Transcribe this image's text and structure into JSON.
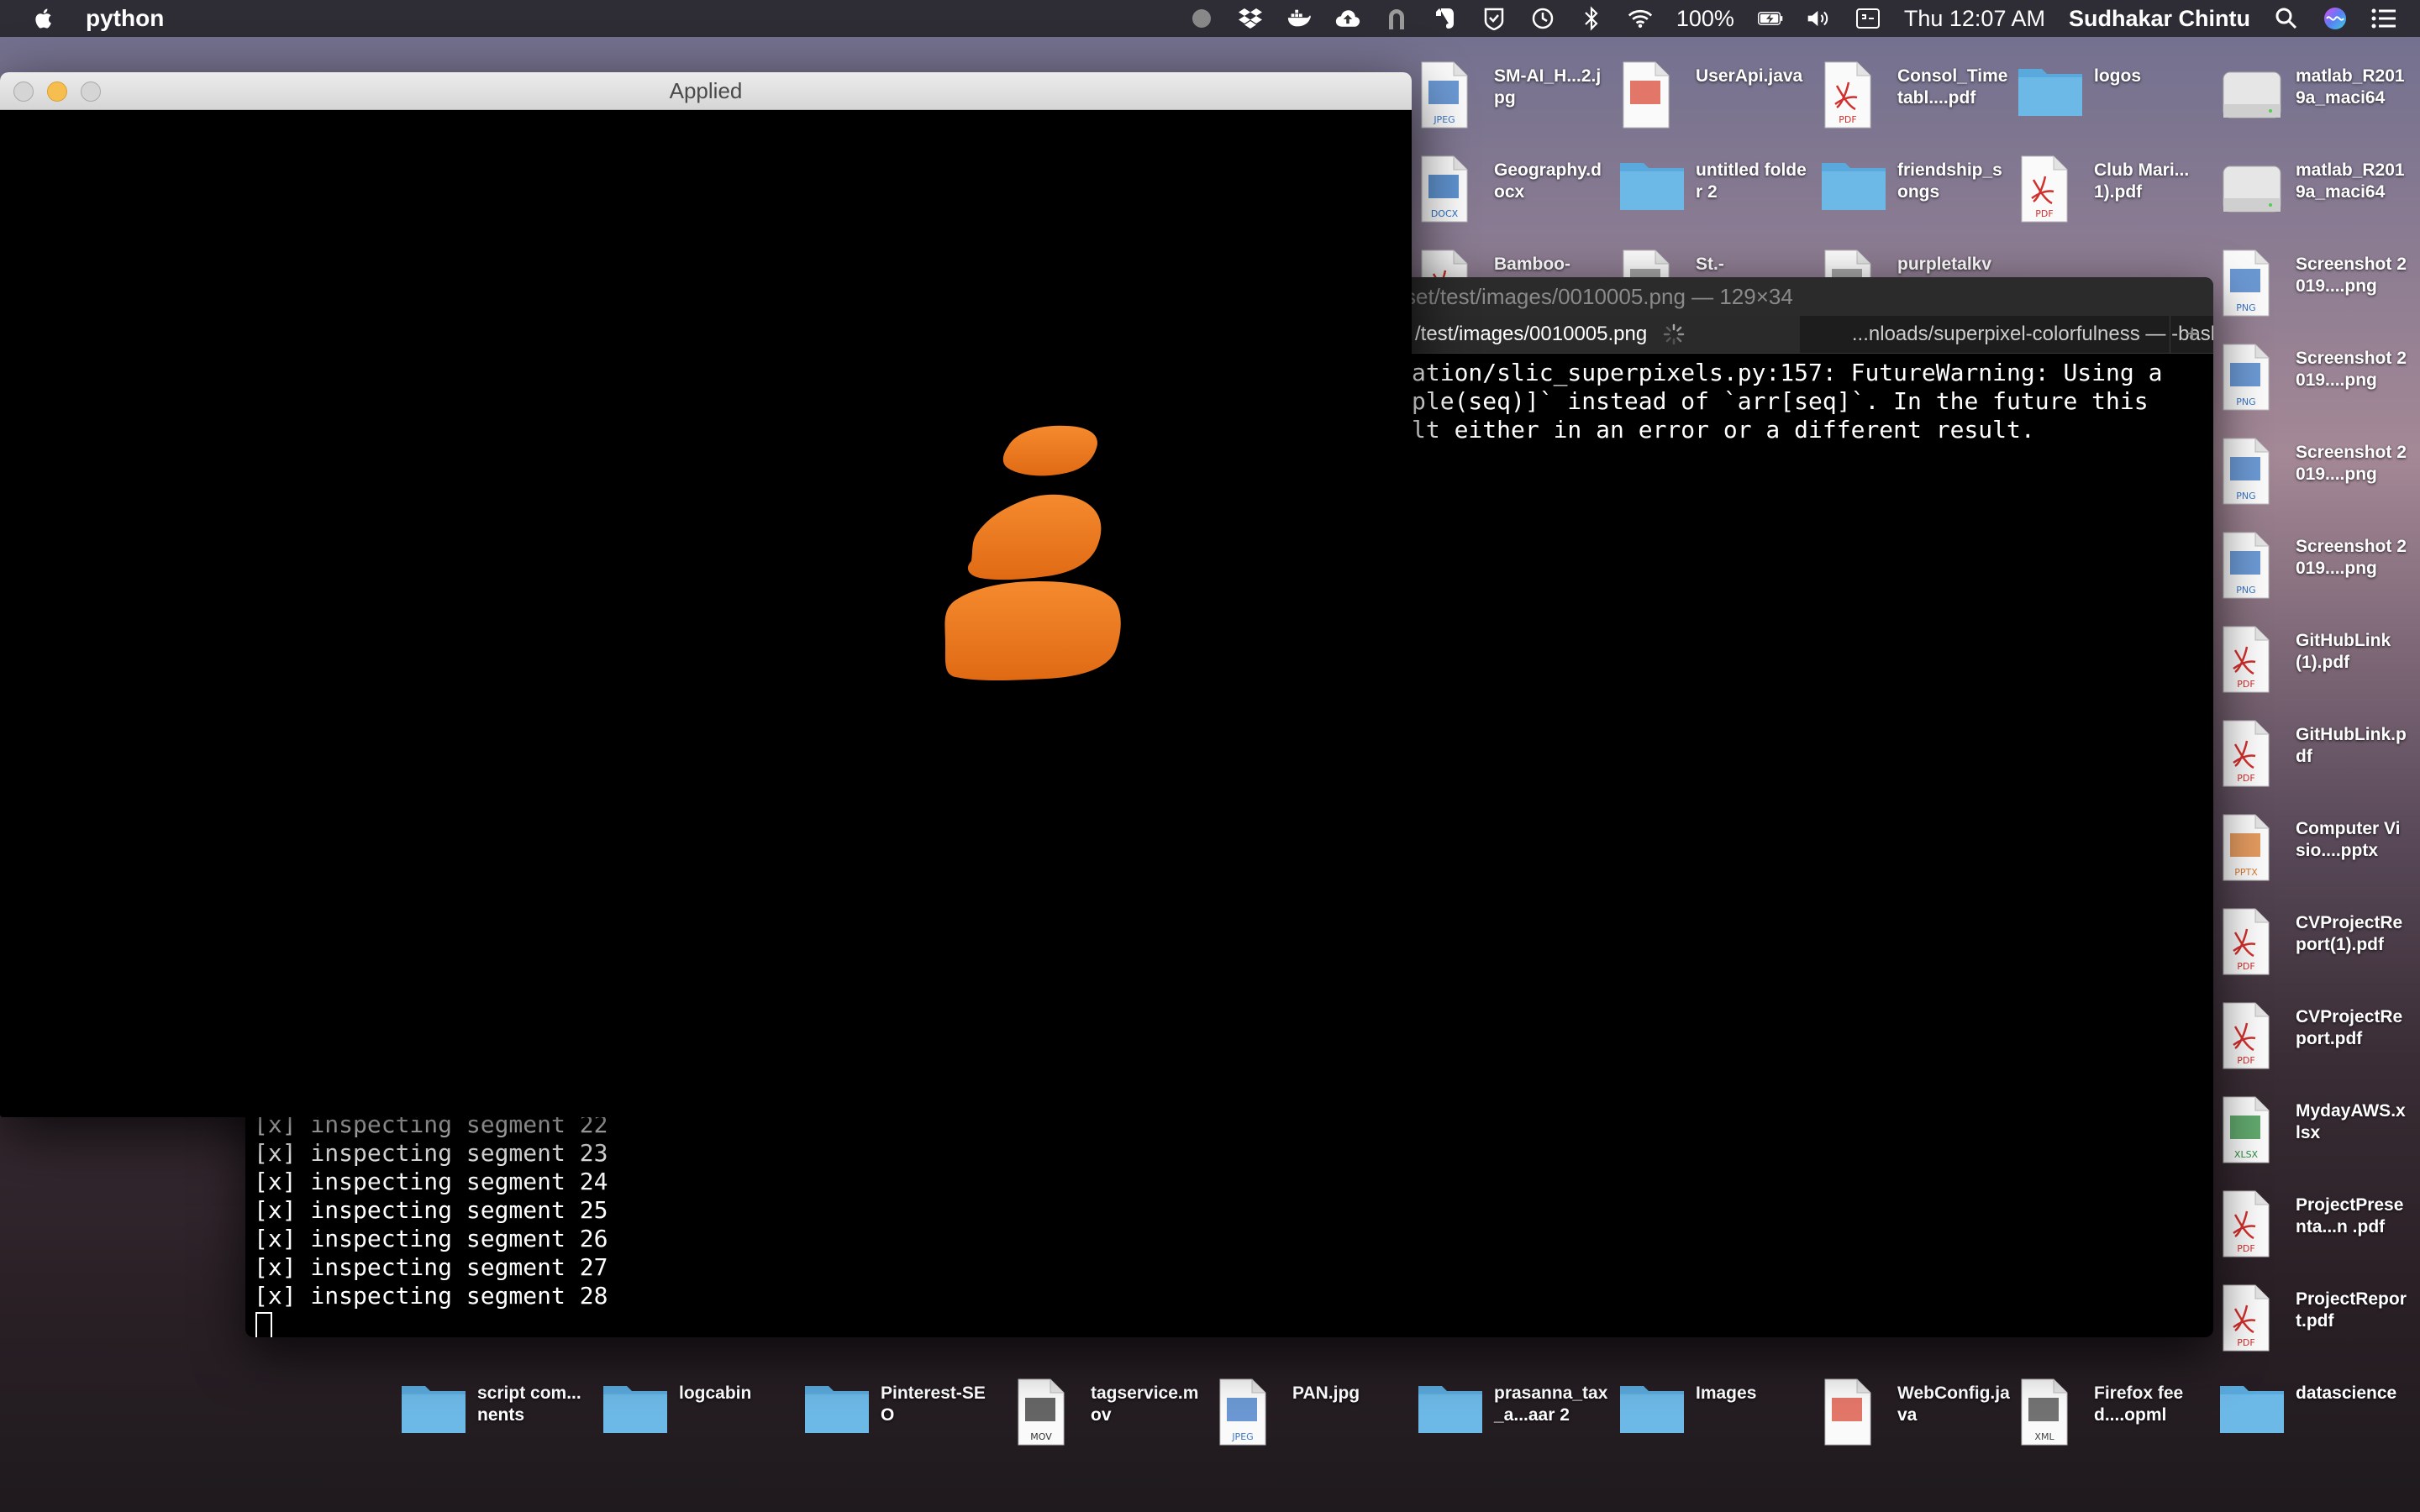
{
  "menubar": {
    "app_name": "python",
    "battery": "100%",
    "clock": "Thu 12:07 AM",
    "user": "Sudhakar Chintu"
  },
  "desktop": {
    "icons": [
      {
        "label": "SM-AI_H...2.jpg",
        "kind": "jpeg"
      },
      {
        "label": "UserApi.java",
        "kind": "java"
      },
      {
        "label": "Consol_Timetabl....pdf",
        "kind": "pdf"
      },
      {
        "label": "logos",
        "kind": "folder"
      },
      {
        "label": "matlab_R2019a_maci64",
        "kind": "disk"
      },
      {
        "label": "Geography.docx",
        "kind": "docx"
      },
      {
        "label": "untitled folder 2",
        "kind": "folder"
      },
      {
        "label": "friendship_songs",
        "kind": "folder"
      },
      {
        "label": "Club Mari...1).pdf",
        "kind": "pdf"
      },
      {
        "label": "matlab_R2019a_maci64",
        "kind": "disk"
      },
      {
        "label": "Bamboo-",
        "kind": "pdf"
      },
      {
        "label": "St.-",
        "kind": "file"
      },
      {
        "label": "purpletalkv",
        "kind": "file"
      },
      {
        "label": "Screenshot 2019....png",
        "kind": "png"
      },
      {
        "label": "Screenshot 2019....png",
        "kind": "png"
      },
      {
        "label": "Screenshot 2019....png",
        "kind": "png"
      },
      {
        "label": "Screenshot 2019....png",
        "kind": "png"
      },
      {
        "label": "GitHubLink(1).pdf",
        "kind": "pdf"
      },
      {
        "label": "GitHubLink.pdf",
        "kind": "pdf"
      },
      {
        "label": "Computer Visio....pptx",
        "kind": "pptx"
      },
      {
        "label": "CVProjectReport(1).pdf",
        "kind": "pdf"
      },
      {
        "label": "CVProjectReport.pdf",
        "kind": "pdf"
      },
      {
        "label": "MydayAWS.xlsx",
        "kind": "xlsx"
      },
      {
        "label": "ProjectPresenta...n .pdf",
        "kind": "pdf"
      },
      {
        "label": "ProjectReport.pdf",
        "kind": "pdf"
      },
      {
        "label": "script com...nents",
        "kind": "folder"
      },
      {
        "label": "logcabin",
        "kind": "folder"
      },
      {
        "label": "Pinterest-SEO",
        "kind": "folder"
      },
      {
        "label": "tagservice.mov",
        "kind": "mov"
      },
      {
        "label": "PAN.jpg",
        "kind": "jpeg"
      },
      {
        "label": "prasanna_tax_a...aar 2",
        "kind": "folder"
      },
      {
        "label": "Images",
        "kind": "folder"
      },
      {
        "label": "WebConfig.java",
        "kind": "java"
      },
      {
        "label": "Firefox feed....opml",
        "kind": "xml"
      },
      {
        "label": "datascience",
        "kind": "folder"
      }
    ]
  },
  "terminal": {
    "title": "set/test/images/0010005.png — 129×34",
    "tabs": [
      {
        "label": "/test/images/0010005.png"
      },
      {
        "label": "...nloads/superpixel-colorfulness — -bash"
      }
    ],
    "add_tab": "+",
    "warning_lines": [
      "ation/slic_superpixels.py:157: FutureWarning: Using a",
      "ple(seq)]` instead of `arr[seq]`. In the future this",
      "lt either in an error or a different result."
    ],
    "output_lines": [
      "[x] inspecting segment 22",
      "[x] inspecting segment 23",
      "[x] inspecting segment 24",
      "[x] inspecting segment 25",
      "[x] inspecting segment 26",
      "[x] inspecting segment 27",
      "[x] inspecting segment 28"
    ]
  },
  "applied_window": {
    "title": "Applied"
  },
  "colors": {
    "folder": "#5aa9dc",
    "pdf_red": "#d0312d",
    "segment_orange": "#f07a24"
  }
}
